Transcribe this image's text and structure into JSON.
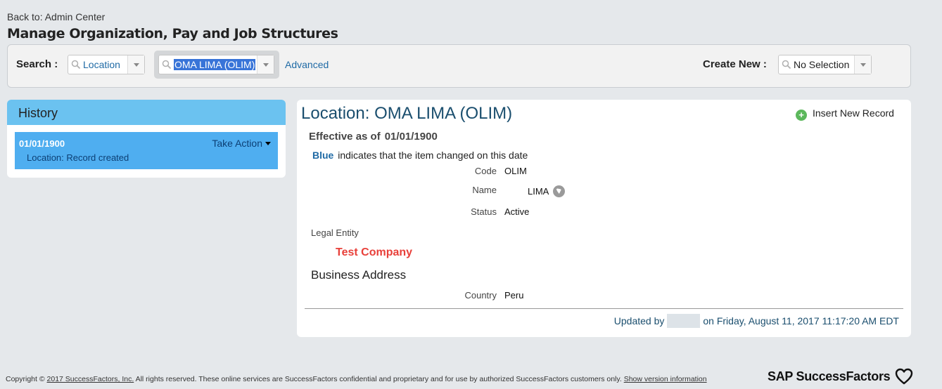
{
  "header": {
    "back_link": "Back to: Admin Center",
    "title": "Manage Organization, Pay and Job Structures"
  },
  "search": {
    "label": "Search :",
    "type_value": "Location",
    "record_value": "OMA LIMA (OLIM)",
    "advanced_label": "Advanced",
    "create_label": "Create New :",
    "create_value": "No Selection"
  },
  "history": {
    "title": "History",
    "items": [
      {
        "date": "01/01/1900",
        "description": "Location: Record created",
        "action_label": "Take Action"
      }
    ]
  },
  "detail": {
    "title": "Location: OMA LIMA (OLIM)",
    "insert_label": "Insert New Record",
    "effective_label": "Effective as of",
    "effective_date": "01/01/1900",
    "legend_blue": "Blue",
    "legend_text": "indicates that the item changed on this date",
    "fields": {
      "code_label": "Code",
      "code_value": "OLIM",
      "name_label": "Name",
      "name_value": "LIMA",
      "status_label": "Status",
      "status_value": "Active",
      "legal_entity_label": "Legal Entity",
      "legal_entity_value": "Test Company",
      "business_address_label": "Business Address",
      "country_label": "Country",
      "country_value": "Peru"
    },
    "updated_prefix": "Updated by",
    "updated_suffix": "on Friday, August 11, 2017 11:17:20 AM EDT"
  },
  "footer": {
    "copyright_prefix": "Copyright ©",
    "copyright_link": "2017 SuccessFactors, Inc.",
    "copyright_text": "All rights reserved. These online services are SuccessFactors confidential and proprietary and for use by authorized SuccessFactors customers only.",
    "version_link": "Show version information",
    "brand": "SAP SuccessFactors"
  },
  "colors": {
    "accent_blue": "#1f6aa5",
    "history_header": "#6bc2f0",
    "history_item": "#4faef0",
    "legal_entity_red": "#e8403a",
    "add_green": "#5cb85c"
  },
  "icons": [
    "search-icon",
    "dropdown-arrow-icon",
    "caret-down-icon",
    "plus-circle-icon",
    "globe-icon",
    "heart-icon"
  ]
}
